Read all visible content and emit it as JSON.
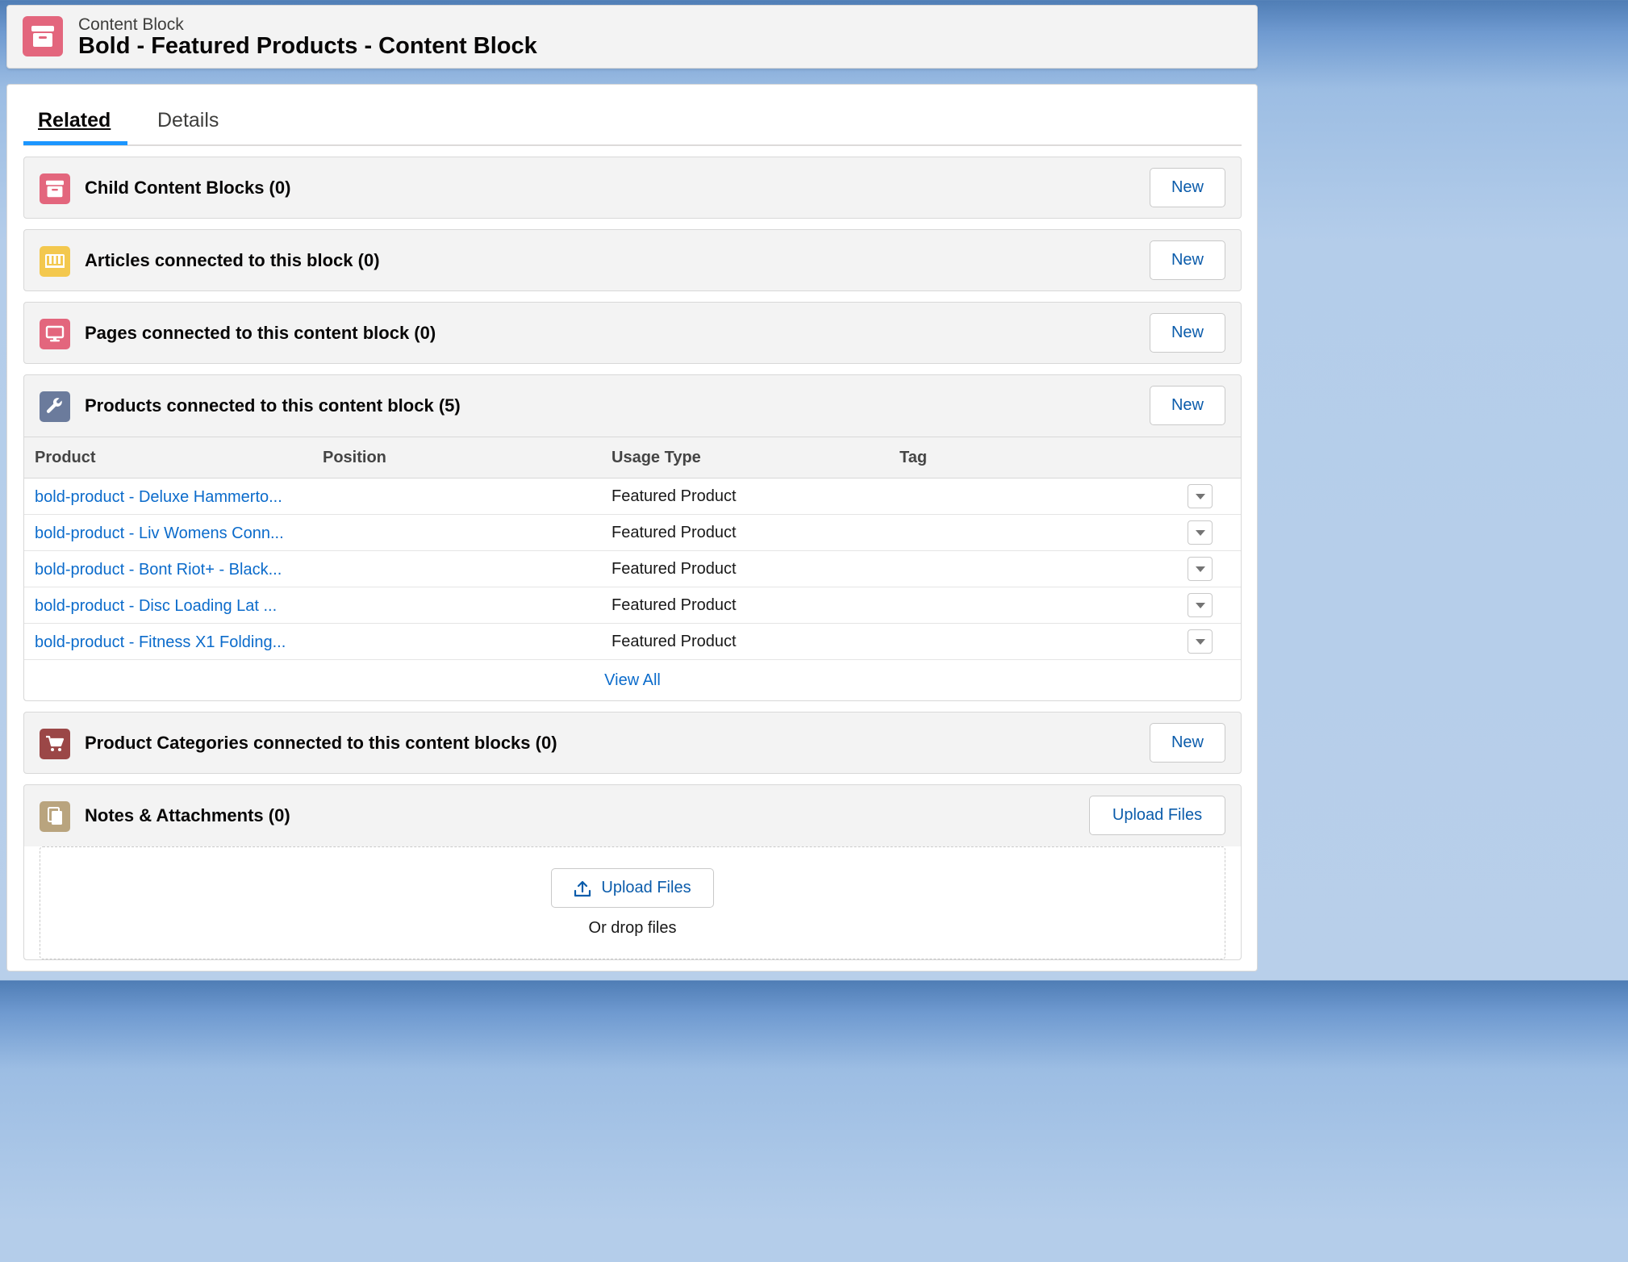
{
  "header": {
    "object_type": "Content Block",
    "title": "Bold - Featured Products - Content Block",
    "icon": "archive-box-icon",
    "icon_color": "#e3667d"
  },
  "tabs": [
    {
      "label": "Related",
      "active": true
    },
    {
      "label": "Details",
      "active": false
    }
  ],
  "related_lists": {
    "child_blocks": {
      "title": "Child Content Blocks (0)",
      "button": "New",
      "icon": "archive-box-icon",
      "icon_color": "#e3667d"
    },
    "articles": {
      "title": "Articles connected to this block (0)",
      "button": "New",
      "icon": "book-icon",
      "icon_color": "#f3c84e"
    },
    "pages": {
      "title": "Pages connected to this content block (0)",
      "button": "New",
      "icon": "monitor-icon",
      "icon_color": "#e3667d"
    },
    "products": {
      "title": "Products connected to this content block (5)",
      "button": "New",
      "icon": "wrench-icon",
      "icon_color": "#6b7b9c",
      "columns": [
        "Product",
        "Position",
        "Usage Type",
        "Tag"
      ],
      "rows": [
        {
          "product": "bold-product - Deluxe Hammerto...",
          "position": "",
          "usage_type": "Featured Product",
          "tag": ""
        },
        {
          "product": "bold-product - Liv Womens Conn...",
          "position": "",
          "usage_type": "Featured Product",
          "tag": ""
        },
        {
          "product": "bold-product - Bont Riot+ - Black...",
          "position": "",
          "usage_type": "Featured Product",
          "tag": ""
        },
        {
          "product": "bold-product - Disc Loading Lat ...",
          "position": "",
          "usage_type": "Featured Product",
          "tag": ""
        },
        {
          "product": "bold-product - Fitness X1 Folding...",
          "position": "",
          "usage_type": "Featured Product",
          "tag": ""
        }
      ],
      "view_all": "View All"
    },
    "categories": {
      "title": "Product Categories connected to this content blocks (0)",
      "button": "New",
      "icon": "cart-icon",
      "icon_color": "#9b4747"
    },
    "notes": {
      "title": "Notes & Attachments (0)",
      "button": "Upload Files",
      "icon": "documents-icon",
      "icon_color": "#b9a47e",
      "drop_button": "Upload Files",
      "drop_text": "Or drop files"
    }
  }
}
